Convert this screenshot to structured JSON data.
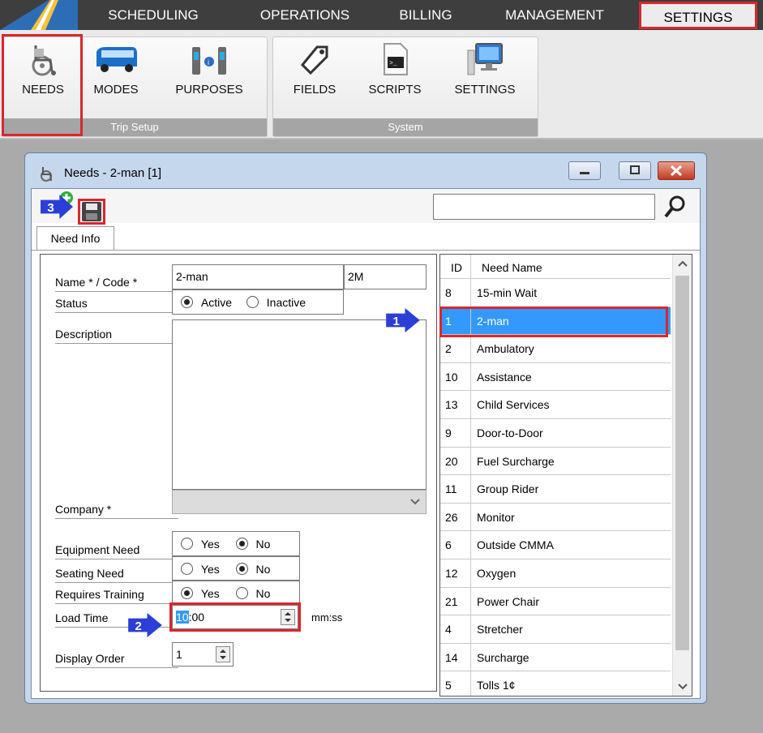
{
  "menu": {
    "items": [
      "SCHEDULING",
      "OPERATIONS",
      "BILLING",
      "MANAGEMENT"
    ],
    "active": "SETTINGS"
  },
  "ribbon": {
    "trip_setup": {
      "label": "Trip Setup",
      "buttons": [
        {
          "label": "NEEDS",
          "icon": "wheelchair-icon"
        },
        {
          "label": "MODES",
          "icon": "bus-icon"
        },
        {
          "label": "PURPOSES",
          "icon": "purposes-icon"
        }
      ]
    },
    "system": {
      "label": "System",
      "buttons": [
        {
          "label": "FIELDS",
          "icon": "tag-icon"
        },
        {
          "label": "SCRIPTS",
          "icon": "script-icon"
        },
        {
          "label": "SETTINGS",
          "icon": "monitor-icon"
        }
      ]
    }
  },
  "window": {
    "title": "Needs - 2-man [1]",
    "tab": "Need Info",
    "search_value": ""
  },
  "form": {
    "name_label": "Name * / Code *",
    "name_value": "2-man",
    "code_value": "2M",
    "status_label": "Status",
    "status_active": "Active",
    "status_inactive": "Inactive",
    "description_label": "Description",
    "description_value": "",
    "company_label": "Company *",
    "equipment_label": "Equipment Need",
    "seating_label": "Seating Need",
    "training_label": "Requires Training",
    "yes": "Yes",
    "no": "No",
    "load_time_label": "Load Time",
    "load_time_minutes": "10",
    "load_time_rest": ":00",
    "load_time_unit": "mm:ss",
    "display_order_label": "Display Order",
    "display_order_value": "1"
  },
  "list": {
    "headers": {
      "id": "ID",
      "name": "Need Name"
    },
    "rows": [
      {
        "id": "8",
        "name": "15-min Wait"
      },
      {
        "id": "1",
        "name": "2-man",
        "selected": true
      },
      {
        "id": "2",
        "name": "Ambulatory"
      },
      {
        "id": "10",
        "name": "Assistance"
      },
      {
        "id": "13",
        "name": "Child Services"
      },
      {
        "id": "9",
        "name": "Door-to-Door"
      },
      {
        "id": "20",
        "name": "Fuel Surcharge"
      },
      {
        "id": "11",
        "name": "Group Rider"
      },
      {
        "id": "26",
        "name": "Monitor"
      },
      {
        "id": "6",
        "name": "Outside CMMA"
      },
      {
        "id": "12",
        "name": "Oxygen"
      },
      {
        "id": "21",
        "name": "Power Chair"
      },
      {
        "id": "4",
        "name": "Stretcher"
      },
      {
        "id": "14",
        "name": "Surcharge"
      },
      {
        "id": "5",
        "name": "Tolls 1¢"
      }
    ]
  },
  "callouts": {
    "one": "1",
    "two": "2",
    "three": "3"
  },
  "colors": {
    "highlight": "#d9272e",
    "selection": "#3399ff",
    "callout": "#2b3fd6"
  }
}
